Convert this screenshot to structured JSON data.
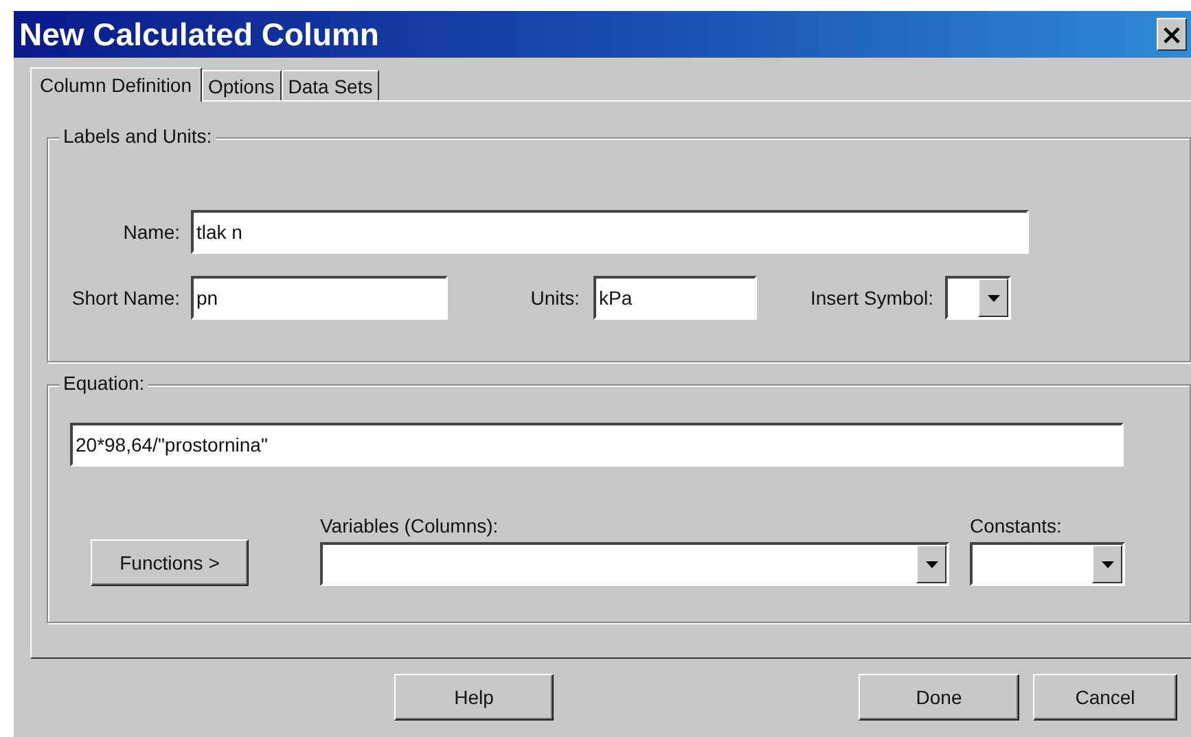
{
  "window": {
    "title": "New Calculated Column",
    "close": "×"
  },
  "tabs": [
    {
      "label": "Column Definition",
      "selected": true
    },
    {
      "label": "Options",
      "selected": false
    },
    {
      "label": "Data Sets",
      "selected": false
    }
  ],
  "labels_and_units": {
    "legend": "Labels and Units:",
    "name": {
      "label": "Name:",
      "value": "tlak n"
    },
    "short_name": {
      "label": "Short Name:",
      "value": "pn"
    },
    "units": {
      "label": "Units:",
      "value": "kPa"
    },
    "insert_symbol": {
      "label": "Insert Symbol:"
    }
  },
  "equation": {
    "legend": "Equation:",
    "value": "20*98,64/\"prostornina\"",
    "functions_button": "Functions >",
    "variables": {
      "label": "Variables (Columns):"
    },
    "constants": {
      "label": "Constants:"
    }
  },
  "buttons": [
    {
      "label": "Help"
    },
    {
      "label": "Done"
    },
    {
      "label": "Cancel"
    }
  ]
}
